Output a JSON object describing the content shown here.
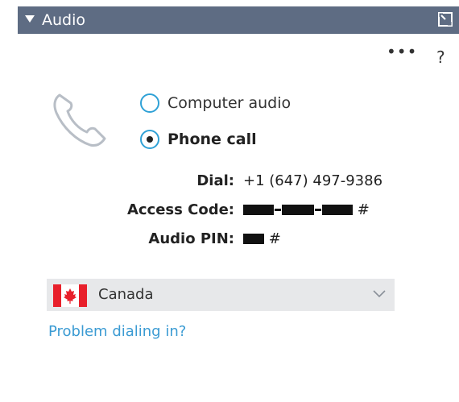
{
  "header": {
    "title": "Audio"
  },
  "toolbar": {
    "more_label": "•••",
    "help_label": "?"
  },
  "audio_options": [
    {
      "label": "Computer audio",
      "selected": false
    },
    {
      "label": "Phone call",
      "selected": true
    }
  ],
  "dial_info": {
    "dial_label": "Dial:",
    "dial_value": "+1 (647) 497-9386",
    "access_label": "Access Code:",
    "access_suffix": "#",
    "pin_label": "Audio PIN:",
    "pin_suffix": "#"
  },
  "country": {
    "selected": "Canada"
  },
  "link": {
    "problem_label": "Problem dialing in?"
  },
  "colors": {
    "header_bg": "#5e6c83",
    "accent": "#2fa1d6",
    "link": "#3b9bd3",
    "flag_red": "#e8202b"
  }
}
